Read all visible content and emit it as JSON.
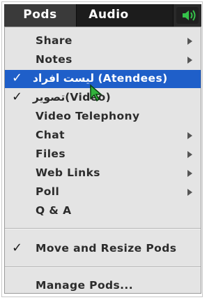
{
  "menubar": {
    "pods_label": "Pods",
    "audio_label": "Audio",
    "speaker_icon": "speaker-volume-icon",
    "speaker_color": "#35c24a"
  },
  "menu": {
    "items": [
      {
        "label": "Share",
        "submenu": true,
        "checked": false
      },
      {
        "label": "Notes",
        "submenu": true,
        "checked": false
      },
      {
        "label": "لیست افراد (Atendees)",
        "submenu": false,
        "checked": true,
        "selected": true
      },
      {
        "label": "تصویر(Video)",
        "submenu": false,
        "checked": true
      },
      {
        "label": "Video Telephony",
        "submenu": false,
        "checked": false
      },
      {
        "label": "Chat",
        "submenu": true,
        "checked": false
      },
      {
        "label": "Files",
        "submenu": true,
        "checked": false
      },
      {
        "label": "Web Links",
        "submenu": true,
        "checked": false
      },
      {
        "label": "Poll",
        "submenu": true,
        "checked": false
      },
      {
        "label": "Q & A",
        "submenu": false,
        "checked": false
      },
      {
        "label": "Move and Resize Pods",
        "submenu": false,
        "checked": true
      },
      {
        "label": "Manage Pods...",
        "submenu": false,
        "checked": false
      }
    ],
    "check_glyph": "✓",
    "highlight_color": "#1f5fc9"
  },
  "cursor": {
    "icon": "pointer-cursor-icon",
    "color": "#32b33c"
  }
}
